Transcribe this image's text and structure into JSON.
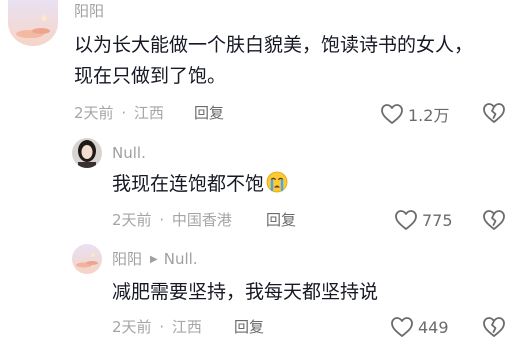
{
  "comments": [
    {
      "author": "阳阳",
      "text_line1": "以为长大能做一个肤白貌美，饱读诗书的女人，",
      "text_line2": "现在只做到了饱。",
      "time": "2天前",
      "location": "江西",
      "reply_label": "回复",
      "likes": "1.2万"
    },
    {
      "author": "Null.",
      "text": "我现在连饱都不饱",
      "emoji": "crying-face",
      "time": "2天前",
      "location": "中国香港",
      "reply_label": "回复",
      "likes": "775"
    },
    {
      "author": "阳阳",
      "reply_to": "Null.",
      "text": "减肥需要坚持，我每天都坚持说",
      "time": "2天前",
      "location": "江西",
      "reply_label": "回复",
      "likes": "449"
    }
  ],
  "separator": "·",
  "colors": {
    "text": "#161823",
    "secondary": "#a0a0a0",
    "icon": "#6b6b6b"
  }
}
